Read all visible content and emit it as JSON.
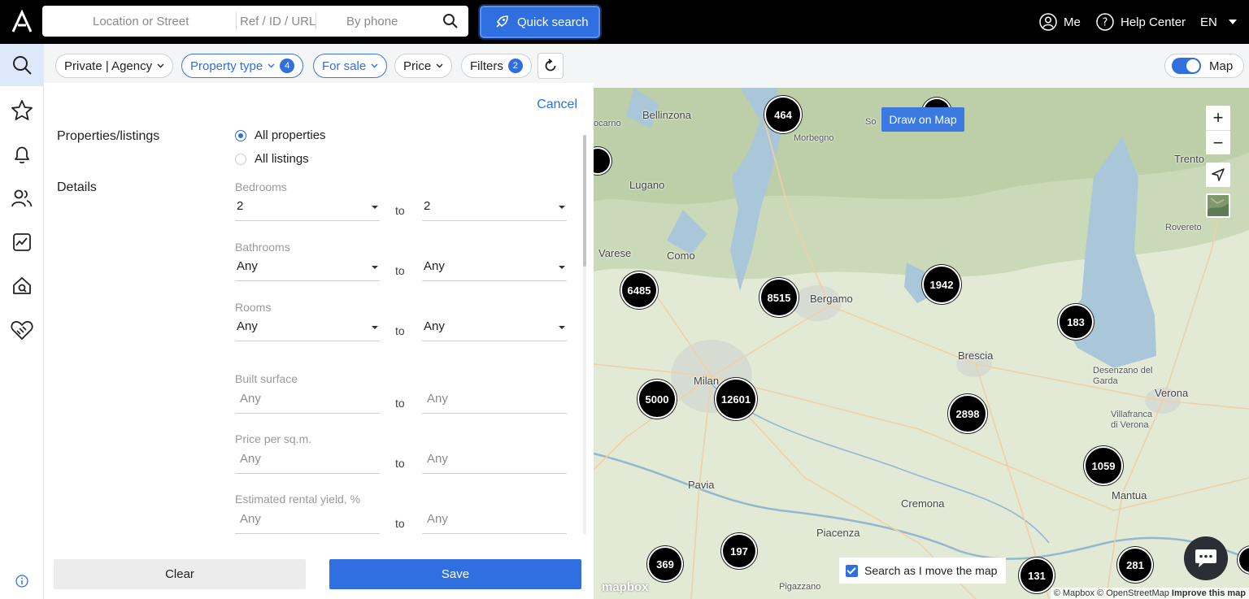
{
  "header": {
    "search": {
      "location_placeholder": "Location or Street",
      "ref_placeholder": "Ref / ID / URL",
      "phone_placeholder": "By phone"
    },
    "quick_search_label": "Quick search",
    "me_label": "Me",
    "help_label": "Help Center",
    "lang_label": "EN"
  },
  "filters": {
    "private_agency": "Private | Agency",
    "property_type": "Property type",
    "property_type_count": "4",
    "for_sale": "For sale",
    "price": "Price",
    "filters": "Filters",
    "filters_count": "2",
    "map_label": "Map"
  },
  "panel": {
    "cancel_label": "Cancel",
    "properties_label": "Properties/listings",
    "all_properties": "All properties",
    "all_listings": "All listings",
    "details_label": "Details",
    "to_label": "to",
    "fields": [
      {
        "label": "Bedrooms",
        "from": "2",
        "to": "2"
      },
      {
        "label": "Bathrooms",
        "from": "Any",
        "to": "Any"
      },
      {
        "label": "Rooms",
        "from": "Any",
        "to": "Any"
      },
      {
        "label": "Built surface",
        "from": "Any",
        "to": "Any"
      },
      {
        "label": "Price per sq.m.",
        "from": "Any",
        "to": "Any"
      },
      {
        "label": "Estimated rental yield, %",
        "from": "Any",
        "to": "Any"
      }
    ],
    "clear_label": "Clear",
    "save_label": "Save"
  },
  "map": {
    "draw_label": "Draw on Map",
    "zoom_in": "+",
    "zoom_out": "−",
    "search_move_label": "Search as I move the map",
    "mapbox_label": "mapbox",
    "attribution": "© Mapbox © OpenStreetMap",
    "improve_label": "Improve this map",
    "cities": [
      "Bellinzona",
      "Morbegno",
      "Lugano",
      "Varese",
      "Como",
      "Bergamo",
      "Brescia",
      "Milan",
      "Pavia",
      "Cremona",
      "Piacenza",
      "Pigazzano",
      "Desenzano del Garda",
      "Verona",
      "Villafranca di Verona",
      "Mantua",
      "Trento",
      "Rovereto",
      "ocarno",
      "So"
    ],
    "clusters": [
      "464",
      "6485",
      "8515",
      "1942",
      "183",
      "5000",
      "12601",
      "2898",
      "1059",
      "369",
      "197",
      "131",
      "281"
    ]
  },
  "colors": {
    "accent": "#2f6fe0",
    "topbar": "#000000",
    "cluster": "#000000"
  }
}
